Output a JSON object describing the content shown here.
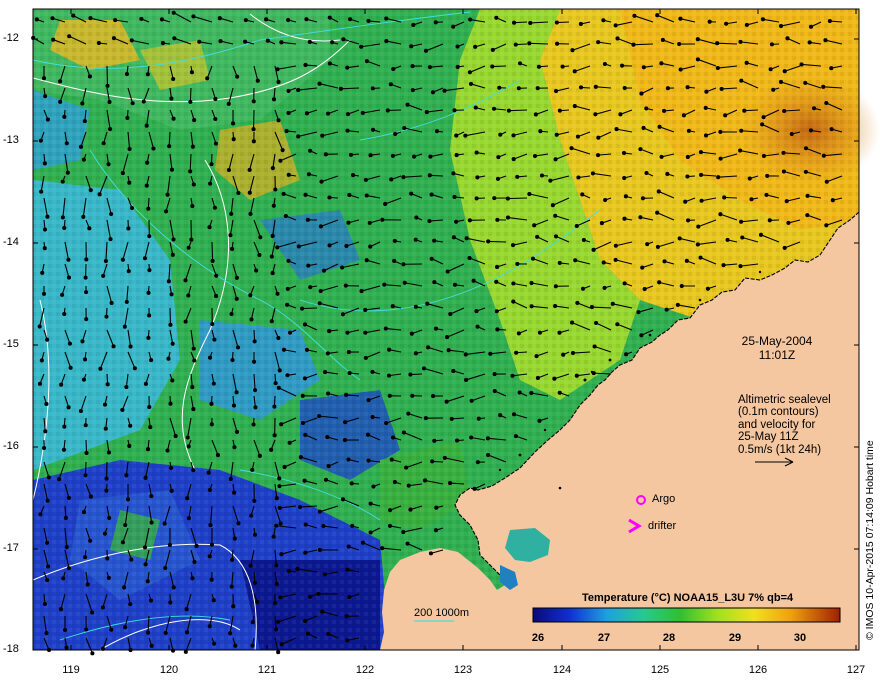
{
  "map": {
    "lat_labels": [
      "-12",
      "-13",
      "-14",
      "-15",
      "-16",
      "-17",
      "-18"
    ],
    "lon_labels": [
      "119",
      "120",
      "121",
      "122",
      "123",
      "124",
      "125",
      "126",
      "127"
    ],
    "date": "25-May-2004",
    "time": "11:01Z",
    "info_lines": [
      "Altimetric sealevel",
      "(0.1m contours)",
      "and velocity for",
      "25-May 11Z",
      "0.5m/s (1kt 24h)"
    ],
    "argo_label": "Argo",
    "drifter_label": "drifter",
    "depth_label": "200  1000m",
    "credit": "© IMOS 10-Apr-2015 07:14:09 Hobart time",
    "colorbar": {
      "title": "Temperature (°C) NOAA15_L3U 7% qb=4",
      "ticks": [
        "26",
        "27",
        "28",
        "29",
        "30"
      ]
    },
    "colors": {
      "land": "#f5c7a0",
      "argo_marker": "#ff00ff",
      "drifter_marker": "#ff00ff",
      "contour": "#ffffff",
      "bathy": "#40e0e0"
    }
  }
}
